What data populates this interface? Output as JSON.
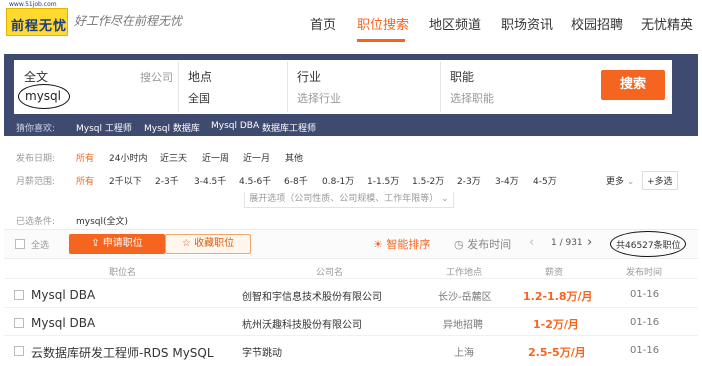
{
  "header": {
    "logo_text": "前程无忧",
    "logo_url": "www.51job.com",
    "slogan": "好工作尽在前程无忧",
    "nav": [
      "首页",
      "职位搜索",
      "地区频道",
      "职场资讯",
      "校园招聘",
      "无忧精英"
    ],
    "nav_active_index": 1
  },
  "search": {
    "fulltext_label": "全文",
    "company_search": "搜公司",
    "fulltext_value": "mysql",
    "location_label": "地点",
    "location_value": "全国",
    "industry_label": "行业",
    "industry_placeholder": "选择行业",
    "function_label": "职能",
    "function_placeholder": "选择职能",
    "button": "搜索",
    "guess_label": "猜你喜欢:",
    "guess_items": [
      "Mysql 工程师",
      "Mysql 数据库",
      "Mysql DBA",
      "数据库工程师"
    ]
  },
  "filters": {
    "date_label": "发布日期:",
    "date_items": [
      "所有",
      "24小时内",
      "近三天",
      "近一周",
      "近一月",
      "其他"
    ],
    "salary_label": "月薪范围:",
    "salary_items": [
      "所有",
      "2千以下",
      "2-3千",
      "3-4.5千",
      "4.5-6千",
      "6-8千",
      "0.8-1万",
      "1-1.5万",
      "1.5-2万",
      "2-3万",
      "3-4万",
      "4-5万"
    ],
    "more": "更多",
    "multi": "+多选",
    "expand": "展开选项（公司性质、公司规模、工作年限等）",
    "selected_label": "已选条件:",
    "selected_value": "mysql(全文)"
  },
  "toolbar": {
    "select_all": "全选",
    "apply": "申请职位",
    "favorite": "收藏职位",
    "smart_sort": "智能排序",
    "publish_time": "发布时间",
    "page": "1 / 931",
    "total": "共46527条职位"
  },
  "table": {
    "headers": [
      "职位名",
      "公司名",
      "工作地点",
      "薪资",
      "发布时间"
    ],
    "rows": [
      {
        "title": "Mysql DBA",
        "company": "创智和宇信息技术股份有限公司",
        "location": "长沙-岳麓区",
        "salary": "1.2-1.8万/月",
        "date": "01-16"
      },
      {
        "title": "Mysql DBA",
        "company": "杭州沃趣科技股份有限公司",
        "location": "异地招聘",
        "salary": "1-2万/月",
        "date": "01-16"
      },
      {
        "title": "云数据库研发工程师-RDS MySQL",
        "company": "字节跳动",
        "location": "上海",
        "salary": "2.5-5万/月",
        "date": "01-16"
      }
    ]
  },
  "colors": {
    "accent": "#f6651f",
    "panel": "#3e4a70",
    "logo_bg": "#ffd92e"
  }
}
